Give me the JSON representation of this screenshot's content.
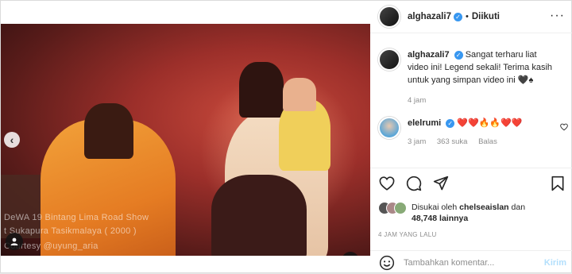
{
  "post": {
    "username": "alghazali7",
    "follow_separator": "•",
    "follow_status": "Diikuti"
  },
  "media": {
    "overlay_line1": "DeWA 19  Bintang Lima  Road Show",
    "overlay_line2": "t Sukapura Tasikmalaya ( 2000 )",
    "overlay_line3": "Courtesy  @uyung_aria",
    "nav_left_glyph": "‹",
    "carousel_dots": 2,
    "carousel_active": 2
  },
  "comments": [
    {
      "username": "alghazali7",
      "text": "Sangat terharu liat video ini! Legend sekali! Terima kasih untuk yang simpan video ini 🖤♠",
      "time": "4 jam"
    },
    {
      "username": "elelrumi",
      "text": "❤️❤️🔥🔥❤️❤️",
      "time": "3 jam",
      "likes": "363 suka",
      "reply": "Balas"
    }
  ],
  "likes": {
    "prefix": "Disukai oleh",
    "user": "chelseaislan",
    "connector": "dan",
    "count": "48,748 lainnya"
  },
  "timeago": "4 JAM YANG LALU",
  "add_comment": {
    "placeholder": "Tambahkan komentar...",
    "post_label": "Kirim"
  },
  "colors": {
    "verified": "#3897f0",
    "post_button": "#b2dffc",
    "heart": "#ed4956"
  }
}
